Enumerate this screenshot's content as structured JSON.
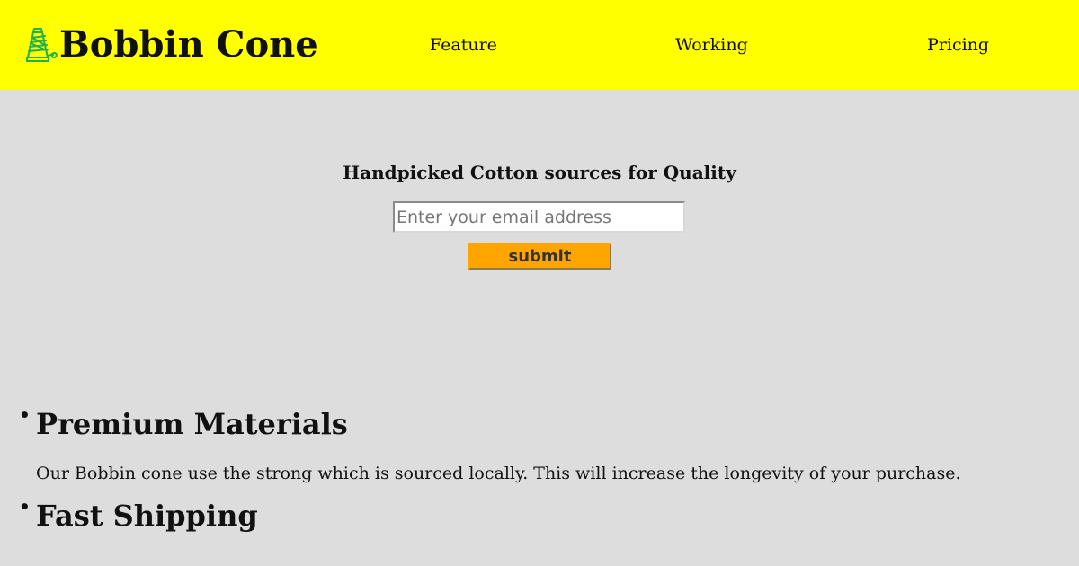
{
  "brand": {
    "name": "Bobbin Cone",
    "logo_icon": "bobbin-cone-icon",
    "header_color": "#ffff00",
    "icon_color": "#22b14c"
  },
  "nav": {
    "items": [
      {
        "label": "Feature"
      },
      {
        "label": "Working"
      },
      {
        "label": "Pricing"
      }
    ]
  },
  "hero": {
    "title": "Handpicked Cotton sources for Quality",
    "email_placeholder": "Enter your email address",
    "email_value": "",
    "submit_label": "submit",
    "submit_color": "#ffa500"
  },
  "features": [
    {
      "heading": "Premium Materials",
      "text": "Our Bobbin cone use the strong which is sourced locally. This will increase the longevity of your purchase."
    },
    {
      "heading": "Fast Shipping",
      "text": ""
    }
  ],
  "page": {
    "background": "#dddddd"
  }
}
